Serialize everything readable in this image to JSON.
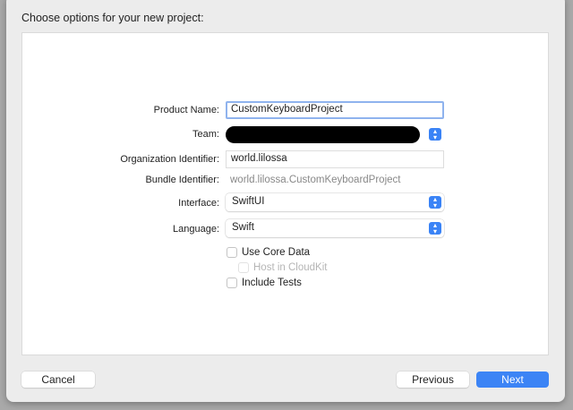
{
  "dialog": {
    "title": "Choose options for your new project:"
  },
  "form": {
    "product_name": {
      "label": "Product Name:",
      "value": "CustomKeyboardProject"
    },
    "team": {
      "label": "Team:"
    },
    "org_id": {
      "label": "Organization Identifier:",
      "value": "world.lilossa"
    },
    "bundle_id": {
      "label": "Bundle Identifier:",
      "value": "world.lilossa.CustomKeyboardProject"
    },
    "interface": {
      "label": "Interface:",
      "value": "SwiftUI"
    },
    "language": {
      "label": "Language:",
      "value": "Swift"
    },
    "use_core_data": {
      "label": "Use Core Data",
      "checked": false
    },
    "host_in_cloudkit": {
      "label": "Host in CloudKit",
      "checked": false,
      "enabled": false
    },
    "include_tests": {
      "label": "Include Tests",
      "checked": false
    }
  },
  "buttons": {
    "cancel": "Cancel",
    "previous": "Previous",
    "next": "Next"
  },
  "colors": {
    "accent": "#3c84f5"
  }
}
